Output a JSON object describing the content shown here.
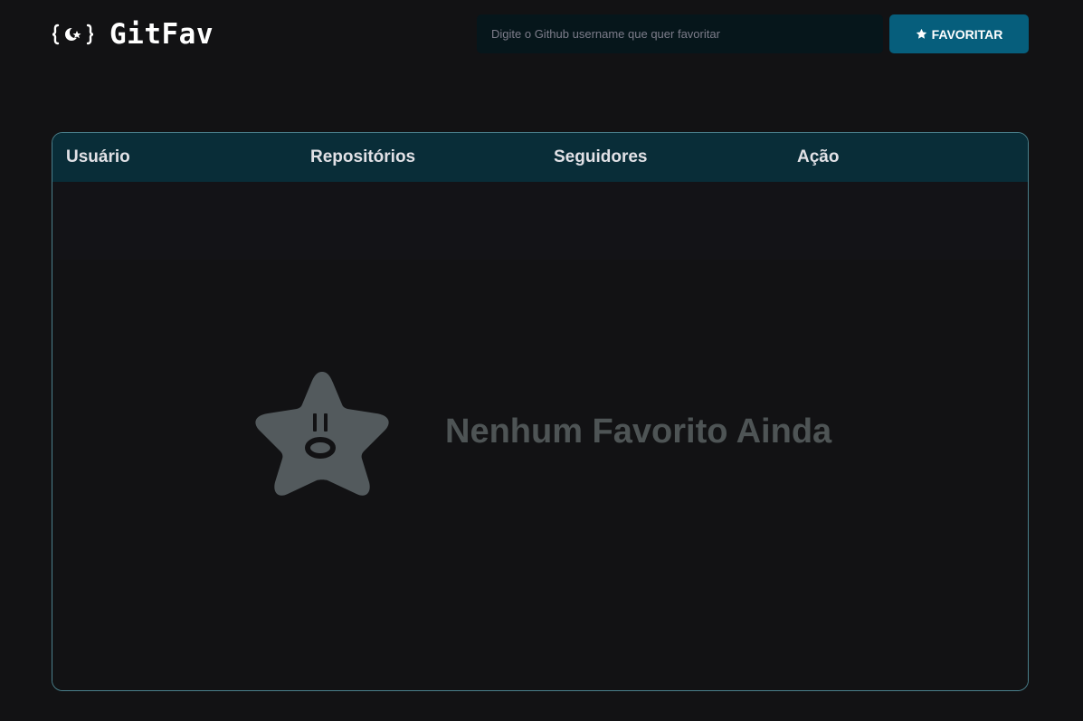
{
  "header": {
    "logo_text": "GitFav",
    "logo_mark_name": "github-star-brackets-logo",
    "search": {
      "placeholder": "Digite o Github username que quer favoritar",
      "value": ""
    },
    "favorite_button_label": "FAVORITAR",
    "favorite_button_icon": "star-icon"
  },
  "table": {
    "columns": [
      "Usuário",
      "Repositórios",
      "Seguidores",
      "Ação"
    ],
    "rows": [],
    "empty_state": {
      "icon": "surprised-star-icon",
      "message": "Nenhum Favorito Ainda"
    }
  },
  "colors": {
    "background": "#121214",
    "accent": "#065e7c",
    "table_header": "#092d38",
    "table_border": "#4a808c",
    "input_bg": "#06161b",
    "empty_text": "#4e5455"
  }
}
